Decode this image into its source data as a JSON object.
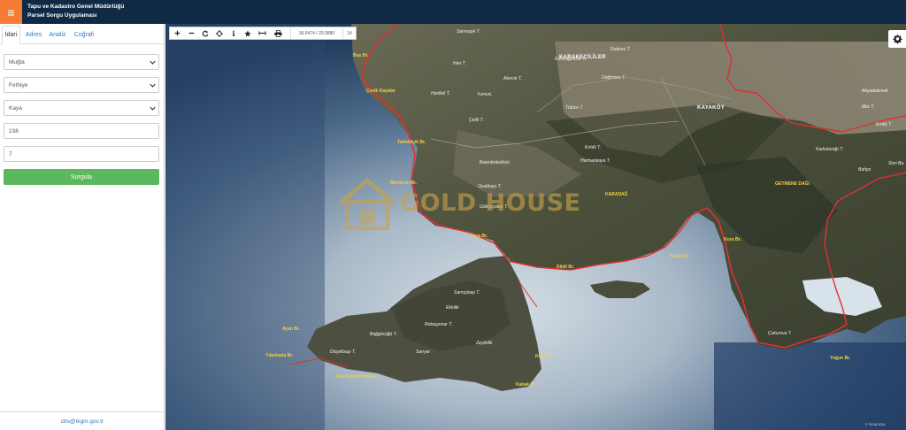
{
  "header": {
    "menu_icon": "hamburger-icon",
    "title_line1": "Tapu ve Kadastro Genel Müdürlüğü",
    "title_line2": "Parsel Sorgu Uygulaması"
  },
  "sidebar": {
    "tabs": [
      {
        "label": "İdari",
        "active": true
      },
      {
        "label": "Adres",
        "active": false
      },
      {
        "label": "Analiz",
        "active": false
      },
      {
        "label": "Coğrafi",
        "active": false
      }
    ],
    "province": "Muğla",
    "district": "Fethiye",
    "neighborhood": "Kaya",
    "block_no": "238",
    "parcel_no": "7",
    "query_label": "Sorgula",
    "footer_email": "cbs@tkgm.gov.tr"
  },
  "toolbar": {
    "tools": [
      "plus-icon",
      "minus-icon",
      "refresh-icon",
      "locate-icon",
      "info-icon",
      "star-icon",
      "measure-icon",
      "print-icon"
    ],
    "coords": "36.5474 / 29.0880",
    "zoom": "14"
  },
  "map": {
    "settings_icon": "gear-icon",
    "villages": [
      {
        "text": "KARAKEÇİLİLER"
      },
      {
        "text": "KAYAKÖY"
      }
    ],
    "places": [
      {
        "text": "Sarmaşık T."
      },
      {
        "text": "Han T."
      },
      {
        "text": "Kızılcagölcük T."
      },
      {
        "text": "Dulamo T."
      },
      {
        "text": "Abırcık T."
      },
      {
        "text": "Değirmen T."
      },
      {
        "text": "Harilleli T."
      },
      {
        "text": "Yumurt."
      },
      {
        "text": "Tülüce T."
      },
      {
        "text": "Çetili T."
      },
      {
        "text": "Kırtıllı T."
      },
      {
        "text": "Belenkisledüzü"
      },
      {
        "text": "Harmankaya T."
      },
      {
        "text": "Oyukbaşı T."
      },
      {
        "text": "Gökçeçukur T."
      },
      {
        "text": "Kadıoturağı T."
      },
      {
        "text": "Bahçe"
      },
      {
        "text": "Kırıklı T."
      },
      {
        "text": "İlbis T."
      },
      {
        "text": "Akçaalakmak"
      },
      {
        "text": "Sarnıçbaşı T."
      },
      {
        "text": "Ekinlik"
      },
      {
        "text": "Robaçpınar T."
      },
      {
        "text": "Zeytinlik"
      },
      {
        "text": "Sarıyar"
      },
      {
        "text": "Döşekbaşı T."
      },
      {
        "text": "Bağgöcüğü T."
      },
      {
        "text": "Sivri Bu."
      },
      {
        "text": "Çukurova T."
      }
    ],
    "capes": [
      {
        "text": "Boy Br."
      },
      {
        "text": "Çevik Kayalar"
      },
      {
        "text": "Tatlıdiliçik Br."
      },
      {
        "text": "Merdiven Br."
      },
      {
        "text": "Kara Br."
      },
      {
        "text": "Dikili Br."
      },
      {
        "text": "Kuru Br."
      },
      {
        "text": "Yılanlı Br."
      },
      {
        "text": "GEYMENE DAĞI"
      },
      {
        "text": "KARADAĞ"
      },
      {
        "text": "Ayan Br."
      },
      {
        "text": "Yılanlıada Br."
      },
      {
        "text": "Küçükçukur Kayası"
      },
      {
        "text": "Kule Br."
      },
      {
        "text": "Kabak Br."
      },
      {
        "text": "Yoğun Br."
      }
    ],
    "watermark": "GOLD HOUSE",
    "credit": "© TKGM 2024"
  }
}
